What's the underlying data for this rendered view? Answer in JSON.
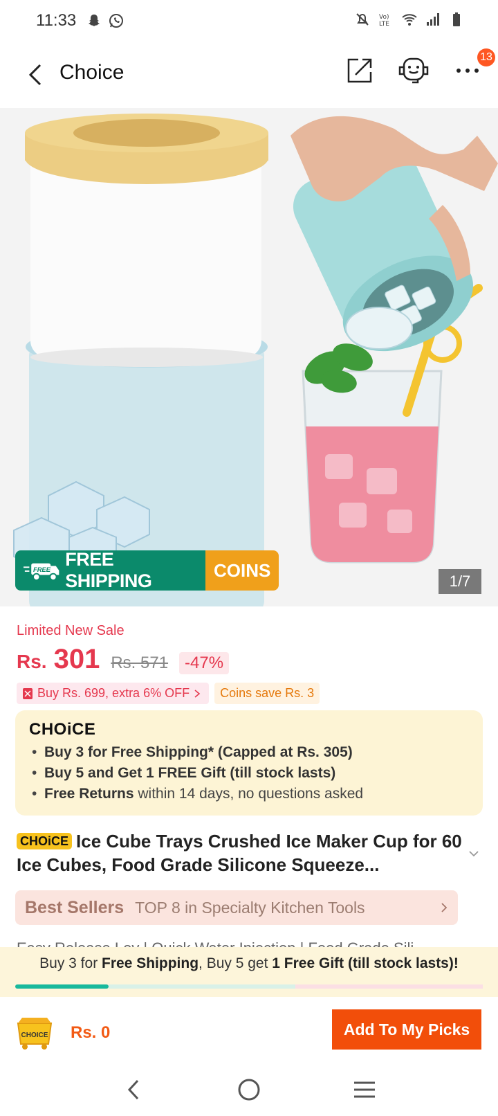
{
  "status_bar": {
    "time": "11:33",
    "left_icons": [
      "snapchat-icon",
      "whatsapp-icon"
    ],
    "right_icons": [
      "mute-icon",
      "volte-icon",
      "wifi-icon",
      "signal-icon",
      "battery-icon"
    ]
  },
  "nav": {
    "title": "Choice",
    "cart_badge": "13",
    "icons": [
      "back-arrow-icon",
      "share-icon",
      "support-agent-icon",
      "more-icon"
    ]
  },
  "hero": {
    "counter": "1/7",
    "free_badge": "FREE",
    "free_shipping_label": "FREE SHIPPING",
    "coins_label": "COINS"
  },
  "price": {
    "sale_label": "Limited New Sale",
    "currency": "Rs.",
    "current": "301",
    "original": "Rs. 571",
    "discount": "-47%"
  },
  "promos": {
    "bundle": "Buy Rs. 699, extra 6% OFF",
    "coins": "Coins save Rs. 3"
  },
  "choice_card": {
    "logo": "CHOiCE",
    "items": [
      {
        "bold": "Buy 3 for  Free Shipping* (Capped at Rs. 305)",
        "rest": ""
      },
      {
        "bold": "Buy 5 and Get 1 FREE Gift (till stock lasts)",
        "rest": ""
      },
      {
        "bold": "Free Returns",
        "rest": " within 14 days, no questions asked"
      }
    ]
  },
  "product": {
    "tag": "CHOiCE",
    "title": "Ice Cube Trays Crushed Ice Maker Cup for 60 Ice Cubes, Food Grade Silicone Squeeze..."
  },
  "best_sellers": {
    "title": "Best Sellers",
    "text": "TOP 8 in Specialty Kitchen Tools"
  },
  "peek_text": "Easy Release Lov | Quick Water Injection | Food Grade Sili",
  "shipping_strip": {
    "part1": "Buy 3 for ",
    "bold1": "Free Shipping",
    "part2": ", Buy 5 get ",
    "bold2": "1 Free Gift (till stock lasts)!",
    "progress": 0.2
  },
  "bottom_bar": {
    "cart_label": "CHOICE",
    "total": "Rs. 0",
    "add_button": "Add To My Picks"
  },
  "colors": {
    "accent": "#f24e0a",
    "sale_red": "#e5384e",
    "shipping_green": "#0b8a6b",
    "coins_orange": "#f0a01b",
    "choice_yellow": "#f7c21d"
  }
}
